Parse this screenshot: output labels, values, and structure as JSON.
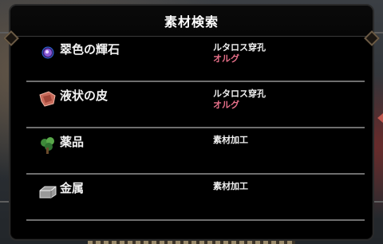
{
  "dialog": {
    "title": "素材検索"
  },
  "items": [
    {
      "name": "翠色の輝石",
      "icon": "purple-gem-icon",
      "source": "ルタロス穿孔",
      "sub": "オルグ"
    },
    {
      "name": "液状の皮",
      "icon": "red-hide-icon",
      "source": "ルタロス穿孔",
      "sub": "オルグ"
    },
    {
      "name": "薬品",
      "icon": "herb-icon",
      "source": "素材加工",
      "sub": ""
    },
    {
      "name": "金属",
      "icon": "metal-ingot-icon",
      "source": "素材加工",
      "sub": ""
    }
  ],
  "colors": {
    "dialog_bg": "#000000",
    "title": "#ffffff",
    "sub_source": "#e8708a",
    "divider": "#6e6e6e"
  }
}
